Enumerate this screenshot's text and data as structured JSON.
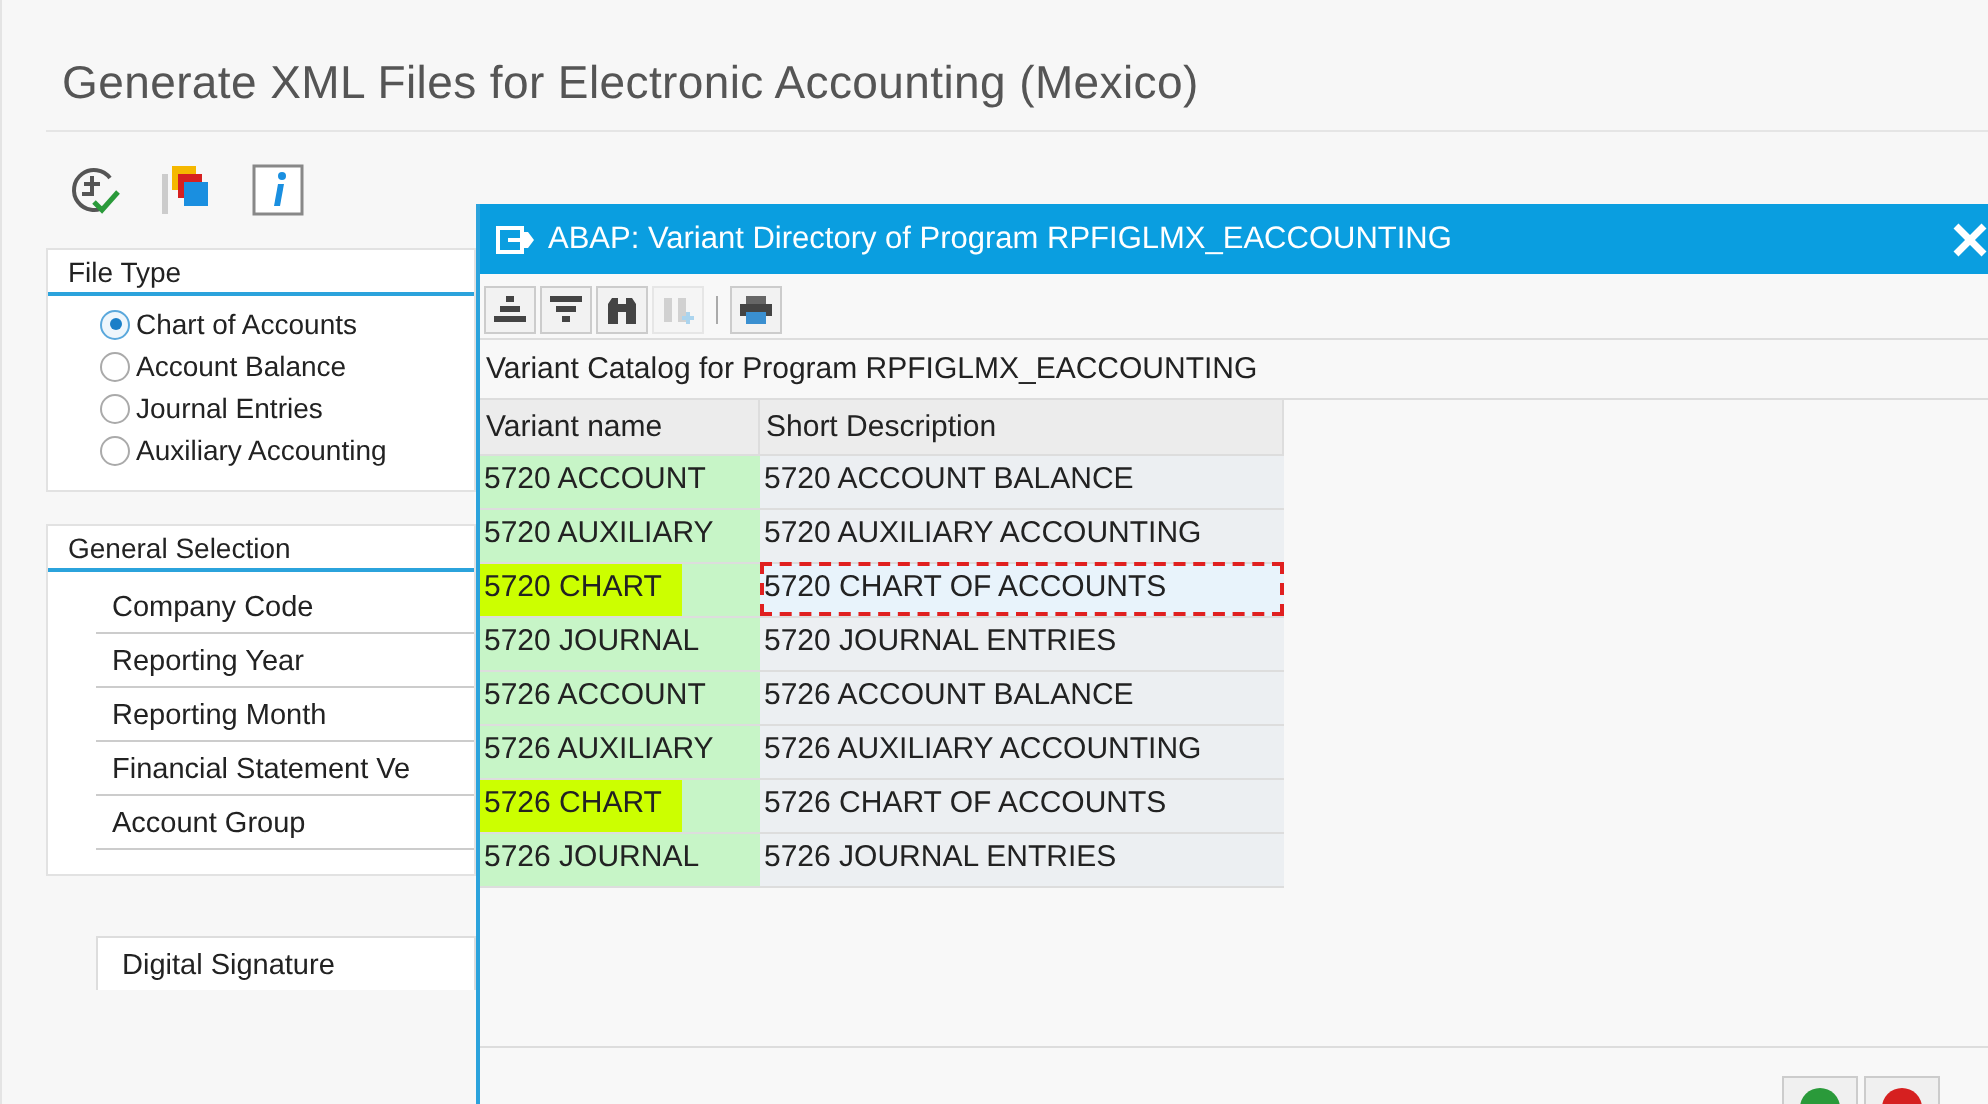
{
  "window": {
    "title": "Generate XML Files for Electronic Accounting (Mexico)"
  },
  "file_type": {
    "title": "File Type",
    "options": [
      {
        "label": "Chart of Accounts",
        "selected": true
      },
      {
        "label": "Account Balance",
        "selected": false
      },
      {
        "label": "Journal Entries",
        "selected": false
      },
      {
        "label": "Auxiliary Accounting",
        "selected": false
      }
    ]
  },
  "general_selection": {
    "title": "General Selection",
    "fields": [
      "Company Code",
      "Reporting Year",
      "Reporting Month",
      "Financial Statement Ve",
      "Account Group"
    ]
  },
  "digital_signature": {
    "title": "Digital Signature"
  },
  "dialog": {
    "title": "ABAP: Variant Directory of Program RPFIGLMX_EACCOUNTING",
    "catalog_label": "Variant Catalog for Program RPFIGLMX_EACCOUNTING",
    "columns": [
      "Variant name",
      "Short Description"
    ],
    "rows": [
      {
        "name": "5720 ACCOUNT",
        "description": "5720 ACCOUNT BALANCE",
        "highlighted": false,
        "selected": false
      },
      {
        "name": "5720 AUXILIARY",
        "description": "5720 AUXILIARY ACCOUNTING",
        "highlighted": false,
        "selected": false
      },
      {
        "name": "5720 CHART",
        "description": "5720 CHART OF ACCOUNTS",
        "highlighted": true,
        "selected": true
      },
      {
        "name": "5720 JOURNAL",
        "description": "5720 JOURNAL ENTRIES",
        "highlighted": false,
        "selected": false
      },
      {
        "name": "5726 ACCOUNT",
        "description": "5726 ACCOUNT BALANCE",
        "highlighted": false,
        "selected": false
      },
      {
        "name": "5726 AUXILIARY",
        "description": "5726 AUXILIARY ACCOUNTING",
        "highlighted": false,
        "selected": false
      },
      {
        "name": "5726 CHART",
        "description": "5726 CHART OF ACCOUNTS",
        "highlighted": true,
        "selected": false
      },
      {
        "name": "5726 JOURNAL",
        "description": "5726 JOURNAL ENTRIES",
        "highlighted": false,
        "selected": false
      }
    ]
  }
}
